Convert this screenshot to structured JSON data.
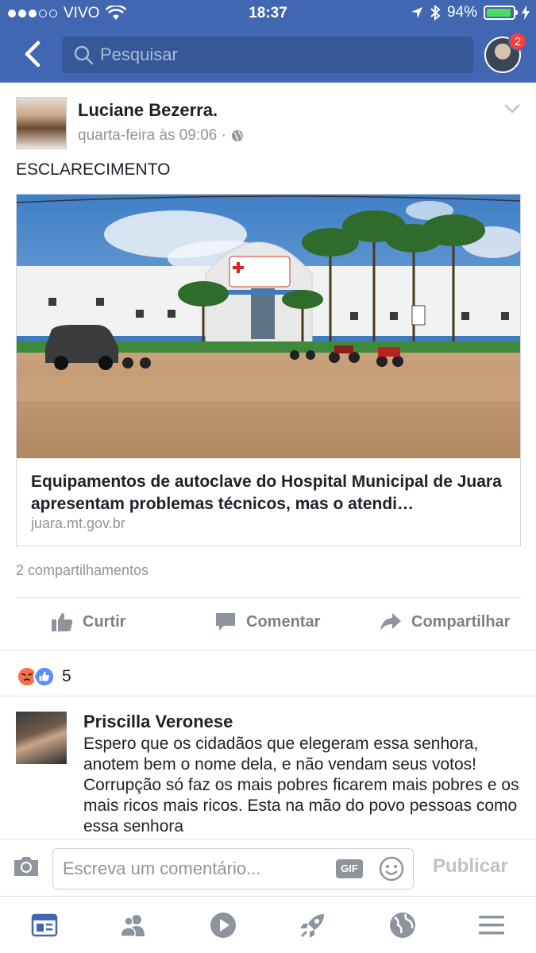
{
  "status_bar": {
    "carrier": "VIVO",
    "time": "18:37",
    "battery": "94%"
  },
  "nav": {
    "search_placeholder": "Pesquisar",
    "notification_count": "2"
  },
  "post": {
    "author": "Luciane Bezerra.",
    "timestamp": "quarta-feira às 09:06 ·",
    "text": "ESCLARECIMENTO",
    "link": {
      "title": "Equipamentos de autoclave do Hospital Municipal de Juara apresentam problemas técnicos, mas o atendi…",
      "domain": "juara.mt.gov.br"
    },
    "shares": "2 compartilhamentos",
    "actions": {
      "like": "Curtir",
      "comment": "Comentar",
      "share": "Compartilhar"
    },
    "reaction_count": "5"
  },
  "comment": {
    "author": "Priscilla Veronese",
    "text": "Espero que os cidadãos que elegeram essa senhora, anotem bem o nome dela, e não vendam seus votos! Corrupção só faz os mais pobres ficarem mais pobres e os mais ricos mais ricos. Esta na mão do povo pessoas como essa senhora"
  },
  "composer": {
    "placeholder": "Escreva um comentário...",
    "gif_label": "GIF",
    "publish": "Publicar"
  },
  "colors": {
    "brand": "#4267b2",
    "like_blue": "#5890ff",
    "angry": "#f7714c"
  }
}
